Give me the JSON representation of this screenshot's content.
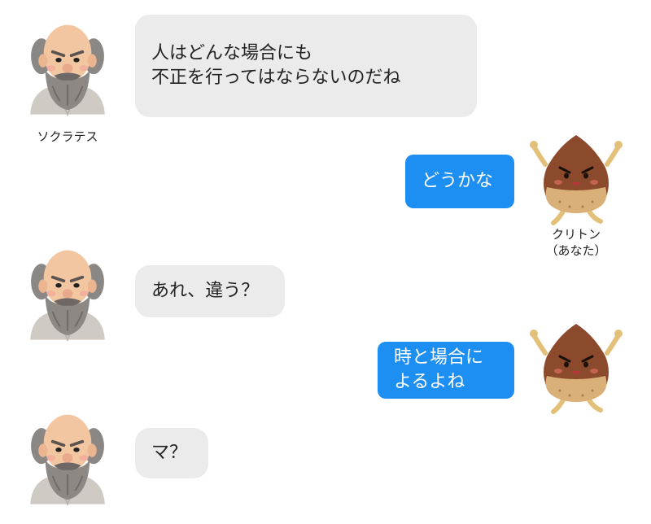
{
  "conversation": {
    "messages": [
      {
        "speaker": "socrates",
        "text": "人はどんな場合にも\n不正を行ってはならないのだね"
      },
      {
        "speaker": "crito",
        "text": "どうかな"
      },
      {
        "speaker": "socrates",
        "text": "あれ、違う？"
      },
      {
        "speaker": "crito",
        "text": "時と場合に\nよるよね"
      },
      {
        "speaker": "socrates",
        "text": "マ？"
      }
    ]
  },
  "speakers": {
    "socrates": {
      "name": "ソクラテス"
    },
    "crito": {
      "name": "クリトン\n（あなた）"
    }
  },
  "colors": {
    "left_bubble": "#ebebeb",
    "right_bubble": "#1d8ff2",
    "right_text": "#ffffff"
  },
  "icons": {
    "socrates": "socrates-avatar-icon",
    "crito": "chestnut-avatar-icon"
  }
}
